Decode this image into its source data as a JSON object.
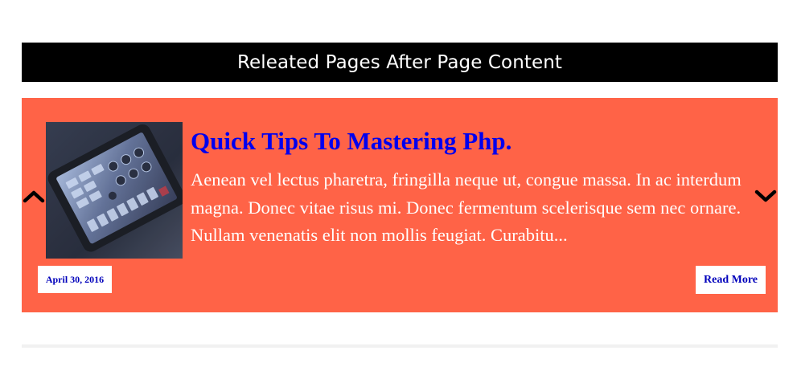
{
  "header": {
    "title": "Releated Pages After Page Content"
  },
  "related": {
    "post": {
      "title": "Quick Tips To Mastering Php.",
      "excerpt": "Aenean vel lectus pharetra, fringilla neque ut, congue massa. In ac interdum magna. Donec vitae risus mi. Donec fermentum scelerisque sem nec ornare. Nullam venenatis elit non mollis feugiat. Curabitu...",
      "date": "April 30, 2016",
      "read_more_label": "Read More",
      "thumbnail_icon": "tablet-photo"
    },
    "nav": {
      "prev_icon": "chevron-up-icon",
      "next_icon": "chevron-down-icon"
    }
  },
  "colors": {
    "header_bg": "#000000",
    "header_text": "#ffffff",
    "panel_bg": "#ff6347",
    "title_link": "#0000ee",
    "excerpt_text": "#ffffff",
    "badge_text": "#0000bb"
  }
}
